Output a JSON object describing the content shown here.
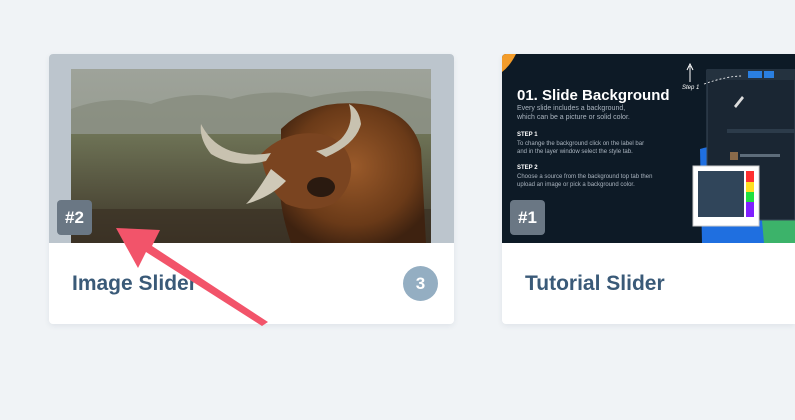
{
  "cards": [
    {
      "id_badge": "#2",
      "title": "Image Slider",
      "count": "3"
    },
    {
      "id_badge": "#1",
      "title": "Tutorial Slider",
      "tutorial": {
        "heading": "01. Slide Background",
        "intro_line1": "Every slide includes a background,",
        "intro_line2": "which can be a picture or solid color.",
        "step1_label": "STEP 1",
        "step1_line1": "To change the background click on the label bar",
        "step1_line2": "and in the layer window select the style tab.",
        "step2_label": "STEP 2",
        "step2_line1": "Choose a source from the background top tab then",
        "step2_line2": "upload an image or pick a background color.",
        "step_callout": "Step 1"
      }
    }
  ],
  "colors": {
    "page_bg": "#f0f3f6",
    "title": "#3a5a78",
    "id_badge_bg": "#6a7784",
    "count_badge_bg": "#94aec2",
    "annotation_arrow": "#f2546a"
  }
}
